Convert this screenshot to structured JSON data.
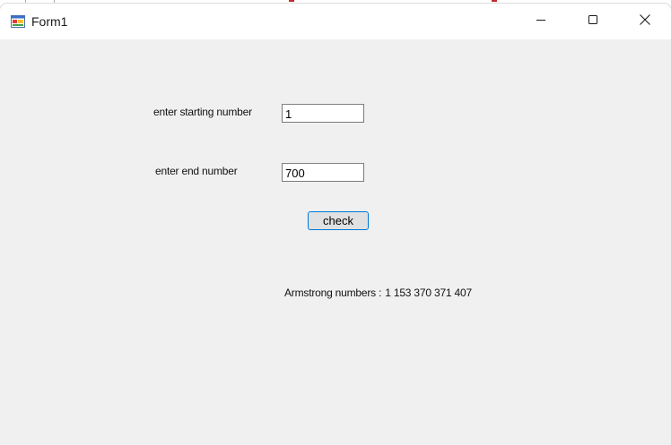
{
  "window": {
    "title": "Form1",
    "controls": {
      "minimize_icon": "minimize-icon",
      "maximize_icon": "maximize-icon",
      "close_icon": "close-icon"
    },
    "app_icon": "form-app-icon"
  },
  "form": {
    "start_label": "enter starting number",
    "start_value": "1",
    "end_label": "enter end number",
    "end_value": "700",
    "check_button": "check",
    "result_label": "Armstrong numbers :",
    "result_value": "1 153 370 371 407"
  },
  "colors": {
    "client_bg": "#f0f0f0",
    "titlebar_bg": "#ffffff",
    "button_border": "#0078d7",
    "button_bg": "#e1e1e1"
  }
}
